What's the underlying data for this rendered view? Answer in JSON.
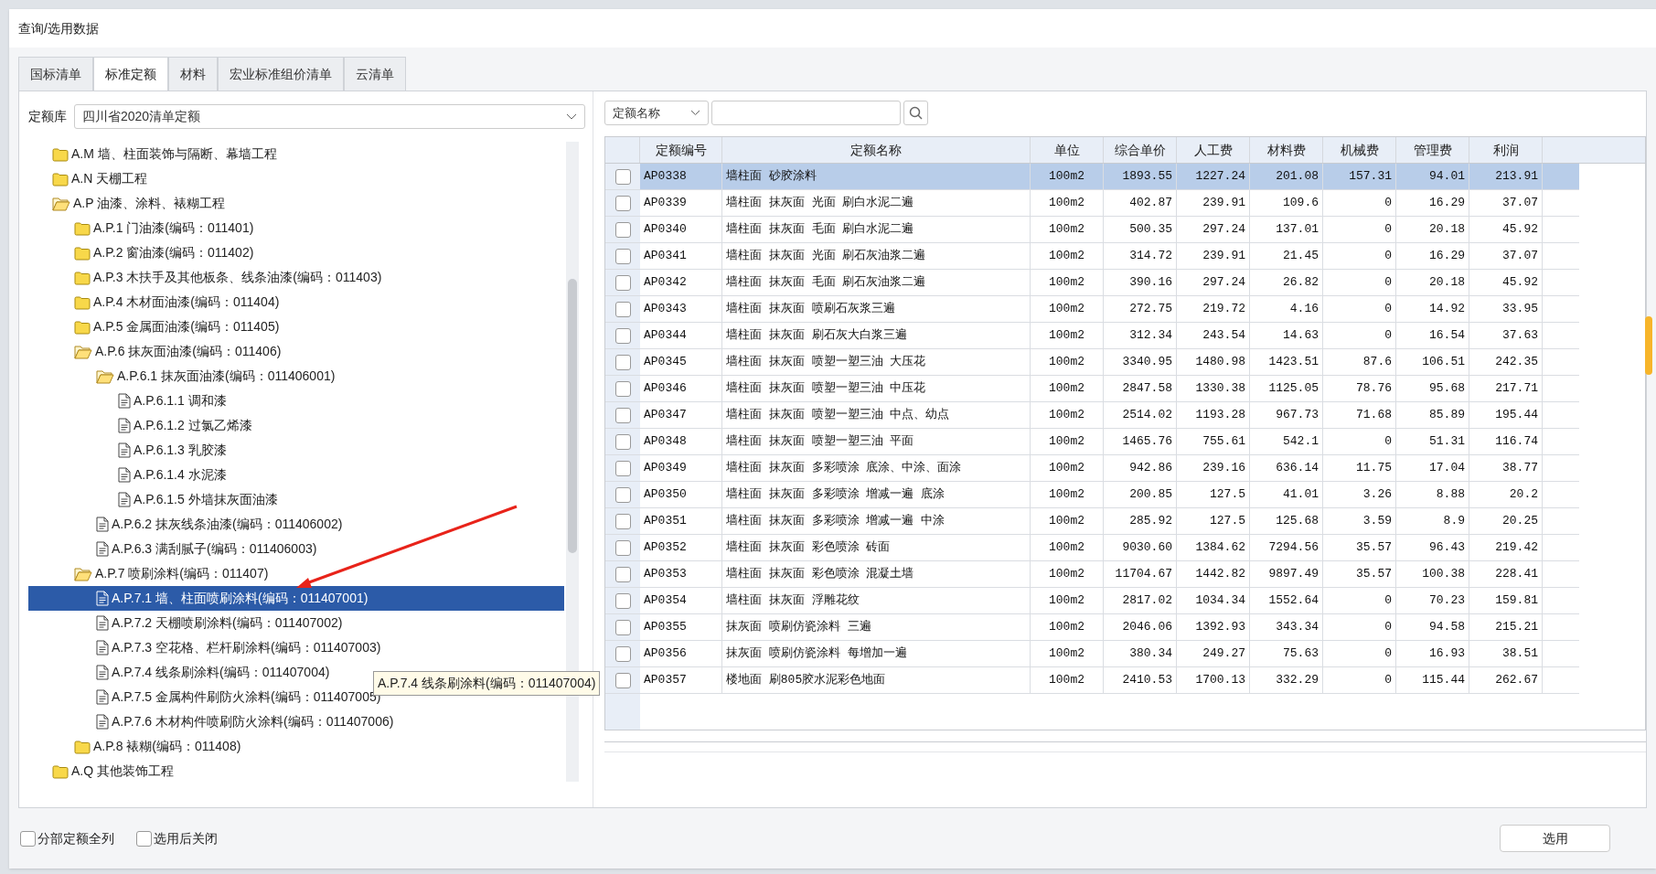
{
  "window": {
    "title": "查询/选用数据"
  },
  "tabs": [
    {
      "label": "国标清单",
      "selected": false
    },
    {
      "label": "标准定额",
      "selected": true
    },
    {
      "label": "材料",
      "selected": false
    },
    {
      "label": "宏业标准组价清单",
      "selected": false
    },
    {
      "label": "云清单",
      "selected": false
    }
  ],
  "library": {
    "label": "定额库",
    "value": "四川省2020清单定额"
  },
  "tree": {
    "items": [
      {
        "kind": "folder",
        "label": "A.M 墙、柱面装饰与隔断、幕墙工程",
        "expanded": false,
        "selected": false
      },
      {
        "kind": "folder",
        "label": "A.N 天棚工程",
        "expanded": false,
        "selected": false
      },
      {
        "kind": "folder",
        "label": "A.P 油漆、涂料、裱糊工程",
        "expanded": true,
        "selected": false,
        "children": [
          {
            "kind": "folder",
            "label": "A.P.1 门油漆(编码：011401)",
            "expanded": false,
            "selected": false
          },
          {
            "kind": "folder",
            "label": "A.P.2 窗油漆(编码：011402)",
            "expanded": false,
            "selected": false
          },
          {
            "kind": "folder",
            "label": "A.P.3 木扶手及其他板条、线条油漆(编码：011403)",
            "expanded": false,
            "selected": false
          },
          {
            "kind": "folder",
            "label": "A.P.4 木材面油漆(编码：011404)",
            "expanded": false,
            "selected": false
          },
          {
            "kind": "folder",
            "label": "A.P.5 金属面油漆(编码：011405)",
            "expanded": false,
            "selected": false
          },
          {
            "kind": "folder",
            "label": "A.P.6 抹灰面油漆(编码：011406)",
            "expanded": true,
            "selected": false,
            "children": [
              {
                "kind": "folder",
                "label": "A.P.6.1 抹灰面油漆(编码：011406001)",
                "expanded": true,
                "selected": false,
                "children": [
                  {
                    "kind": "file",
                    "label": "A.P.6.1.1 调和漆",
                    "selected": false
                  },
                  {
                    "kind": "file",
                    "label": "A.P.6.1.2 过氯乙烯漆",
                    "selected": false
                  },
                  {
                    "kind": "file",
                    "label": "A.P.6.1.3 乳胶漆",
                    "selected": false
                  },
                  {
                    "kind": "file",
                    "label": "A.P.6.1.4 水泥漆",
                    "selected": false
                  },
                  {
                    "kind": "file",
                    "label": "A.P.6.1.5 外墙抹灰面油漆",
                    "selected": false
                  }
                ]
              },
              {
                "kind": "file",
                "label": "A.P.6.2 抹灰线条油漆(编码：011406002)",
                "selected": false
              },
              {
                "kind": "file",
                "label": "A.P.6.3 满刮腻子(编码：011406003)",
                "selected": false
              }
            ]
          },
          {
            "kind": "folder",
            "label": "A.P.7 喷刷涂料(编码：011407)",
            "expanded": true,
            "selected": false,
            "children": [
              {
                "kind": "file",
                "label": "A.P.7.1 墙、柱面喷刷涂料(编码：011407001)",
                "selected": true
              },
              {
                "kind": "file",
                "label": "A.P.7.2 天棚喷刷涂料(编码：011407002)",
                "selected": false
              },
              {
                "kind": "file",
                "label": "A.P.7.3 空花格、栏杆刷涂料(编码：011407003)",
                "selected": false
              },
              {
                "kind": "file",
                "label": "A.P.7.4 线条刷涂料(编码：011407004)",
                "selected": false
              },
              {
                "kind": "file",
                "label": "A.P.7.5 金属构件刷防火涂料(编码：011407005)",
                "selected": false
              },
              {
                "kind": "file",
                "label": "A.P.7.6 木材构件喷刷防火涂料(编码：011407006)",
                "selected": false
              }
            ]
          },
          {
            "kind": "folder",
            "label": "A.P.8 裱糊(编码：011408)",
            "expanded": false,
            "selected": false
          }
        ]
      },
      {
        "kind": "folder",
        "label": "A.Q 其他装饰工程",
        "expanded": false,
        "selected": false
      }
    ]
  },
  "tooltip": "A.P.7.4 线条刷涂料(编码：011407004)",
  "search": {
    "field": "定额名称"
  },
  "table": {
    "columns": [
      "定额编号",
      "定额名称",
      "单位",
      "综合单价",
      "人工费",
      "材料费",
      "机械费",
      "管理费",
      "利润"
    ],
    "rows": [
      {
        "checked": false,
        "selected": true,
        "cells": [
          "AP0338",
          "墙柱面 砂胶涂料",
          "100m2",
          "1893.55",
          "1227.24",
          "201.08",
          "157.31",
          "94.01",
          "213.91"
        ]
      },
      {
        "checked": false,
        "selected": false,
        "cells": [
          "AP0339",
          "墙柱面 抹灰面 光面 刷白水泥二遍",
          "100m2",
          "402.87",
          "239.91",
          "109.6",
          "0",
          "16.29",
          "37.07"
        ]
      },
      {
        "checked": false,
        "selected": false,
        "cells": [
          "AP0340",
          "墙柱面 抹灰面 毛面 刷白水泥二遍",
          "100m2",
          "500.35",
          "297.24",
          "137.01",
          "0",
          "20.18",
          "45.92"
        ]
      },
      {
        "checked": false,
        "selected": false,
        "cells": [
          "AP0341",
          "墙柱面 抹灰面 光面 刷石灰油浆二遍",
          "100m2",
          "314.72",
          "239.91",
          "21.45",
          "0",
          "16.29",
          "37.07"
        ]
      },
      {
        "checked": false,
        "selected": false,
        "cells": [
          "AP0342",
          "墙柱面 抹灰面 毛面 刷石灰油浆二遍",
          "100m2",
          "390.16",
          "297.24",
          "26.82",
          "0",
          "20.18",
          "45.92"
        ]
      },
      {
        "checked": false,
        "selected": false,
        "cells": [
          "AP0343",
          "墙柱面 抹灰面 喷刷石灰浆三遍",
          "100m2",
          "272.75",
          "219.72",
          "4.16",
          "0",
          "14.92",
          "33.95"
        ]
      },
      {
        "checked": false,
        "selected": false,
        "cells": [
          "AP0344",
          "墙柱面 抹灰面 刷石灰大白浆三遍",
          "100m2",
          "312.34",
          "243.54",
          "14.63",
          "0",
          "16.54",
          "37.63"
        ]
      },
      {
        "checked": false,
        "selected": false,
        "cells": [
          "AP0345",
          "墙柱面 抹灰面 喷塑一塑三油 大压花",
          "100m2",
          "3340.95",
          "1480.98",
          "1423.51",
          "87.6",
          "106.51",
          "242.35"
        ]
      },
      {
        "checked": false,
        "selected": false,
        "cells": [
          "AP0346",
          "墙柱面 抹灰面 喷塑一塑三油 中压花",
          "100m2",
          "2847.58",
          "1330.38",
          "1125.05",
          "78.76",
          "95.68",
          "217.71"
        ]
      },
      {
        "checked": false,
        "selected": false,
        "cells": [
          "AP0347",
          "墙柱面 抹灰面 喷塑一塑三油 中点、幼点",
          "100m2",
          "2514.02",
          "1193.28",
          "967.73",
          "71.68",
          "85.89",
          "195.44"
        ]
      },
      {
        "checked": false,
        "selected": false,
        "cells": [
          "AP0348",
          "墙柱面 抹灰面 喷塑一塑三油 平面",
          "100m2",
          "1465.76",
          "755.61",
          "542.1",
          "0",
          "51.31",
          "116.74"
        ]
      },
      {
        "checked": false,
        "selected": false,
        "cells": [
          "AP0349",
          "墙柱面 抹灰面 多彩喷涂 底涂、中涂、面涂",
          "100m2",
          "942.86",
          "239.16",
          "636.14",
          "11.75",
          "17.04",
          "38.77"
        ]
      },
      {
        "checked": false,
        "selected": false,
        "cells": [
          "AP0350",
          "墙柱面 抹灰面 多彩喷涂 增减一遍 底涂",
          "100m2",
          "200.85",
          "127.5",
          "41.01",
          "3.26",
          "8.88",
          "20.2"
        ]
      },
      {
        "checked": false,
        "selected": false,
        "cells": [
          "AP0351",
          "墙柱面 抹灰面 多彩喷涂 增减一遍 中涂",
          "100m2",
          "285.92",
          "127.5",
          "125.68",
          "3.59",
          "8.9",
          "20.25"
        ]
      },
      {
        "checked": false,
        "selected": false,
        "cells": [
          "AP0352",
          "墙柱面 抹灰面 彩色喷涂 砖面",
          "100m2",
          "9030.60",
          "1384.62",
          "7294.56",
          "35.57",
          "96.43",
          "219.42"
        ]
      },
      {
        "checked": false,
        "selected": false,
        "cells": [
          "AP0353",
          "墙柱面 抹灰面 彩色喷涂 混凝土墙",
          "100m2",
          "11704.67",
          "1442.82",
          "9897.49",
          "35.57",
          "100.38",
          "228.41"
        ]
      },
      {
        "checked": false,
        "selected": false,
        "cells": [
          "AP0354",
          "墙柱面 抹灰面 浮雕花纹",
          "100m2",
          "2817.02",
          "1034.34",
          "1552.64",
          "0",
          "70.23",
          "159.81"
        ]
      },
      {
        "checked": false,
        "selected": false,
        "cells": [
          "AP0355",
          "抹灰面 喷刷仿瓷涂料 三遍",
          "100m2",
          "2046.06",
          "1392.93",
          "343.34",
          "0",
          "94.58",
          "215.21"
        ]
      },
      {
        "checked": false,
        "selected": false,
        "cells": [
          "AP0356",
          "抹灰面 喷刷仿瓷涂料 每增加一遍",
          "100m2",
          "380.34",
          "249.27",
          "75.63",
          "0",
          "16.93",
          "38.51"
        ]
      },
      {
        "checked": false,
        "selected": false,
        "cells": [
          "AP0357",
          "楼地面 刷805胶水泥彩色地面",
          "100m2",
          "2410.53",
          "1700.13",
          "332.29",
          "0",
          "115.44",
          "262.67"
        ]
      }
    ]
  },
  "options": [
    {
      "label": "分部定额全列",
      "checked": false
    },
    {
      "label": "选用后关闭",
      "checked": false
    }
  ],
  "buttons": [
    "选用"
  ]
}
